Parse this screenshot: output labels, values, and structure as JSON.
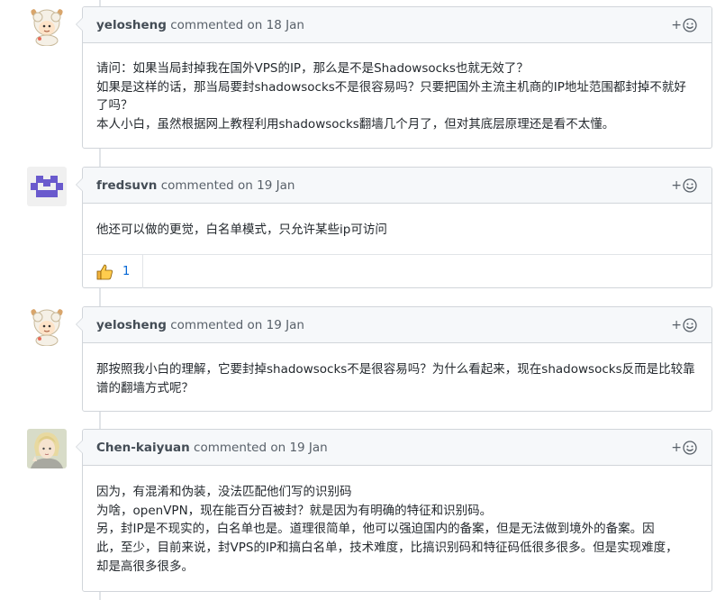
{
  "comments": [
    {
      "author": "yelosheng",
      "meta": "commented on 18 Jan",
      "avatar": "sheep-avatar",
      "body": [
        "请问：如果当局封掉我在国外VPS的IP，那么是不是Shadowsocks也就无效了？",
        "如果是这样的话，那当局要封shadowsocks不是很容易吗？只要把国外主流主机商的IP地址范围都封掉不就好",
        "了吗？",
        "本人小白，虽然根据网上教程利用shadowsocks翻墙几个月了，但对其底层原理还是看不太懂。"
      ]
    },
    {
      "author": "fredsuvn",
      "meta": "commented on 19 Jan",
      "avatar": "identicon-avatar",
      "body": [
        "他还可以做的更觉，白名单模式，只允许某些ip可访问"
      ],
      "reactions": [
        {
          "emoji": "👍",
          "icon": "thumbs-up-icon",
          "count": "1"
        }
      ]
    },
    {
      "author": "yelosheng",
      "meta": "commented on 19 Jan",
      "avatar": "sheep-avatar",
      "body": [
        "那按照我小白的理解，它要封掉shadowsocks不是很容易吗？为什么看起来，现在shadowsocks反而是比较靠",
        "谱的翻墙方式呢？"
      ]
    },
    {
      "author": "Chen-kaiyuan",
      "meta": "commented on 19 Jan",
      "avatar": "anime-avatar",
      "body": [
        "因为，有混淆和伪装，没法匹配他们写的识别码",
        "为啥，openVPN，现在能百分百被封？就是因为有明确的特征和识别码。",
        "另，封IP是不现实的，白名单也是。道理很简单，他可以强迫国内的备案，但是无法做到境外的备案。因",
        "此，至少，目前来说，封VPS的IP和搞白名单，技术难度，比搞识别码和特征码低很多很多。但是实现难度，",
        "却是高很多很多。"
      ]
    }
  ],
  "ui": {
    "add_reaction_plus": "+",
    "add_reaction_icon": "smiley-icon"
  }
}
